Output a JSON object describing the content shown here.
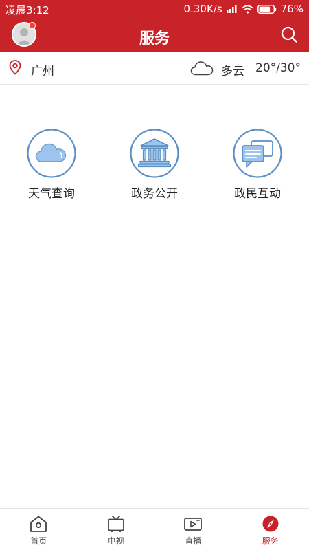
{
  "status_bar": {
    "time": "凌晨3:12",
    "speed": "0.30K/s",
    "battery": "76%"
  },
  "header": {
    "title": "服务"
  },
  "location": {
    "city": "广州",
    "weather_condition": "多云",
    "temperature": "20°/30°"
  },
  "services": [
    {
      "label": "天气查询",
      "icon": "cloud-icon"
    },
    {
      "label": "政务公开",
      "icon": "government-building-icon"
    },
    {
      "label": "政民互动",
      "icon": "chat-bubbles-icon"
    }
  ],
  "bottom_nav": {
    "items": [
      {
        "label": "首页",
        "icon": "home-icon",
        "active": false
      },
      {
        "label": "电视",
        "icon": "tv-icon",
        "active": false
      },
      {
        "label": "直播",
        "icon": "live-video-icon",
        "active": false
      },
      {
        "label": "服务",
        "icon": "compass-icon",
        "active": true
      }
    ]
  },
  "colors": {
    "brand_red": "#c9232a",
    "icon_blue": "#5b8fc4",
    "icon_fill": "#9cc4ec"
  }
}
